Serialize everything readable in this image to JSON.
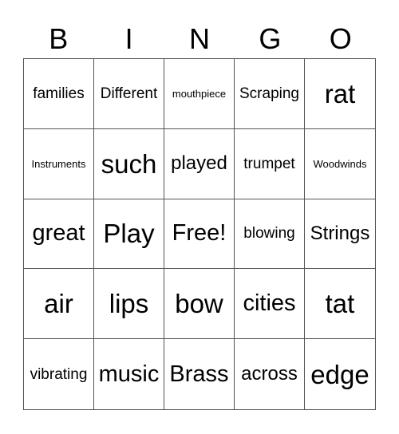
{
  "header": {
    "letters": [
      "B",
      "I",
      "N",
      "G",
      "O"
    ]
  },
  "card": {
    "rows": [
      [
        {
          "text": "families",
          "size": "s"
        },
        {
          "text": "Different",
          "size": "s"
        },
        {
          "text": "mouthpiece",
          "size": "xs"
        },
        {
          "text": "Scraping",
          "size": "s"
        },
        {
          "text": "rat",
          "size": "xl"
        }
      ],
      [
        {
          "text": "Instruments",
          "size": "xs"
        },
        {
          "text": "such",
          "size": "xl"
        },
        {
          "text": "played",
          "size": "m"
        },
        {
          "text": "trumpet",
          "size": "s"
        },
        {
          "text": "Woodwinds",
          "size": "xs"
        }
      ],
      [
        {
          "text": "great",
          "size": "l"
        },
        {
          "text": "Play",
          "size": "xl"
        },
        {
          "text": "Free!",
          "size": "l"
        },
        {
          "text": "blowing",
          "size": "s"
        },
        {
          "text": "Strings",
          "size": "m"
        }
      ],
      [
        {
          "text": "air",
          "size": "xl"
        },
        {
          "text": "lips",
          "size": "xl"
        },
        {
          "text": "bow",
          "size": "xl"
        },
        {
          "text": "cities",
          "size": "l"
        },
        {
          "text": "tat",
          "size": "xl"
        }
      ],
      [
        {
          "text": "vibrating",
          "size": "s"
        },
        {
          "text": "music",
          "size": "l"
        },
        {
          "text": "Brass",
          "size": "l"
        },
        {
          "text": "across",
          "size": "m"
        },
        {
          "text": "edge",
          "size": "xl"
        }
      ]
    ]
  }
}
